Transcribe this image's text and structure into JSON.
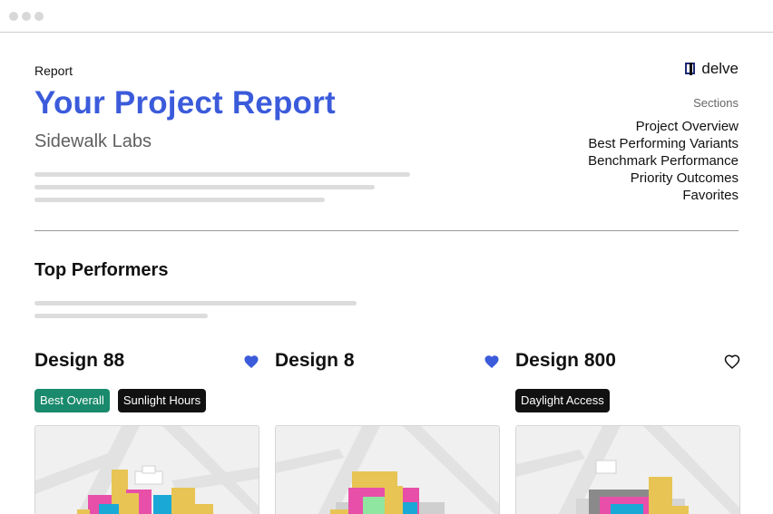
{
  "header": {
    "report_label": "Report",
    "title": "Your Project Report",
    "subtitle": "Sidewalk Labs"
  },
  "brand": {
    "name": "delve"
  },
  "sections": {
    "label": "Sections",
    "items": [
      {
        "label": "Project Overview"
      },
      {
        "label": "Best Performing Variants"
      },
      {
        "label": "Benchmark Performance"
      },
      {
        "label": "Priority Outcomes"
      },
      {
        "label": "Favorites"
      }
    ]
  },
  "top_performers": {
    "title": "Top Performers",
    "designs": [
      {
        "name": "Design 88",
        "favorited": true,
        "tags": [
          {
            "label": "Best Overall",
            "color": "#1a8a6c"
          },
          {
            "label": "Sunlight Hours",
            "color": "#111111"
          }
        ]
      },
      {
        "name": "Design 8",
        "favorited": true,
        "tags": []
      },
      {
        "name": "Design 800",
        "favorited": false,
        "tags": [
          {
            "label": "Daylight Access",
            "color": "#111111"
          }
        ]
      }
    ]
  },
  "colors": {
    "accent": "#3b5bdb",
    "heart_filled": "#3b5bdb",
    "tag_green": "#1a8a6c",
    "tag_black": "#111111"
  }
}
